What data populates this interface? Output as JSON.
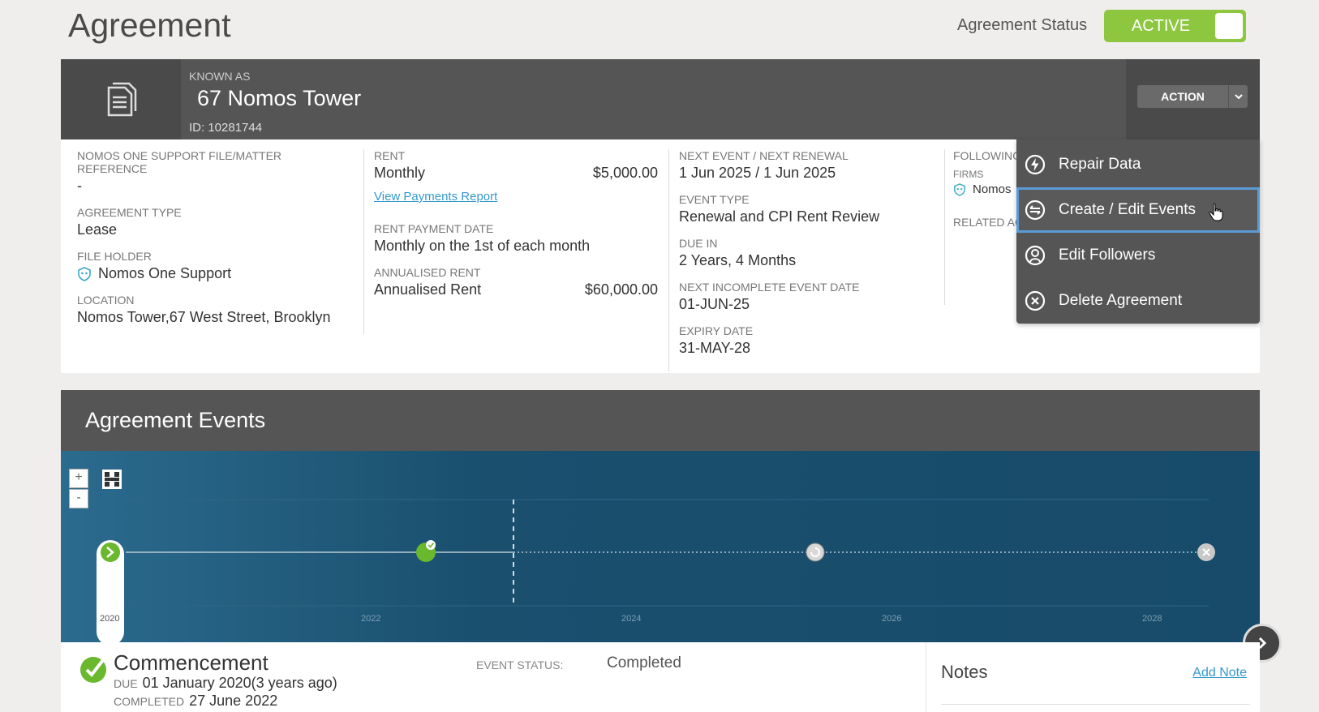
{
  "page": {
    "title": "Agreement"
  },
  "status": {
    "label": "Agreement Status",
    "value": "ACTIVE"
  },
  "header": {
    "known_as_label": "KNOWN AS",
    "name": "67 Nomos Tower",
    "id": "ID: 10281744",
    "action_label": "ACTION"
  },
  "col1": {
    "ref_label": "NOMOS ONE SUPPORT FILE/MATTER REFERENCE",
    "ref_value": "-",
    "type_label": "AGREEMENT TYPE",
    "type_value": "Lease",
    "holder_label": "FILE HOLDER",
    "holder_value": "Nomos One Support",
    "location_label": "LOCATION",
    "location_value": "Nomos Tower,67 West Street, Brooklyn"
  },
  "col2": {
    "rent_label": "RENT",
    "rent_freq": "Monthly",
    "rent_amount": "$5,000.00",
    "payments_link": "View Payments Report",
    "pay_date_label": "RENT PAYMENT DATE",
    "pay_date_value": "Monthly on the 1st of each month",
    "annual_label": "ANNUALISED RENT",
    "annual_name": "Annualised Rent",
    "annual_amount": "$60,000.00"
  },
  "col3": {
    "next_label": "NEXT EVENT / NEXT RENEWAL",
    "next_value": "1 Jun 2025 / 1 Jun 2025",
    "event_type_label": "EVENT TYPE",
    "event_type_value": "Renewal and CPI Rent Review",
    "due_in_label": "DUE IN",
    "due_in_value": "2 Years, 4 Months",
    "incomplete_label": "NEXT INCOMPLETE EVENT DATE",
    "incomplete_value": "01-JUN-25",
    "expiry_label": "EXPIRY DATE",
    "expiry_value": "31-MAY-28"
  },
  "col4": {
    "following_label": "FOLLOWING",
    "firms_label": "FIRMS",
    "firm_value": "Nomos",
    "related_label": "RELATED AC"
  },
  "dropdown": {
    "items": [
      {
        "label": "Repair Data",
        "icon": "lightning-icon"
      },
      {
        "label": "Create / Edit Events",
        "icon": "swap-icon"
      },
      {
        "label": "Edit Followers",
        "icon": "person-icon"
      },
      {
        "label": "Delete Agreement",
        "icon": "close-circle-icon"
      }
    ]
  },
  "events": {
    "title": "Agreement Events",
    "zoom_in": "+",
    "zoom_out": "-",
    "years": [
      "2020",
      "2022",
      "2024",
      "2026",
      "2028"
    ]
  },
  "event_detail": {
    "title": "Commencement",
    "due_label": "DUE",
    "due_value": "01 January 2020(3 years ago)",
    "completed_label": "COMPLETED",
    "completed_value": "27 June 2022",
    "status_label": "EVENT STATUS:",
    "status_value": "Completed"
  },
  "notes": {
    "title": "Notes",
    "add_label": "Add Note"
  },
  "colors": {
    "active_green": "#8dc63f",
    "header_gray": "#555555",
    "link_blue": "#3399cc",
    "timeline_blue": "#174b69"
  }
}
